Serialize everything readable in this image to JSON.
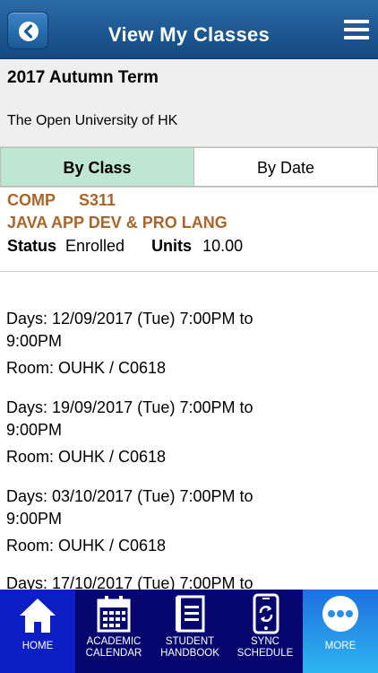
{
  "header": {
    "title": "View My Classes"
  },
  "term": {
    "title": "2017 Autumn Term",
    "university": "The Open University of HK"
  },
  "tabs": {
    "by_class": "By Class",
    "by_date": "By Date"
  },
  "class": {
    "subject": "COMP",
    "catalog": "S311",
    "name": "JAVA APP DEV & PRO LANG",
    "status_label": "Status",
    "status_value": "Enrolled",
    "units_label": "Units",
    "units_value": "10.00"
  },
  "sessions": [
    {
      "days": "Days: 12/09/2017 (Tue) 7:00PM to 9:00PM",
      "room": "Room: OUHK / C0618"
    },
    {
      "days": "Days: 19/09/2017 (Tue) 7:00PM to 9:00PM",
      "room": "Room: OUHK / C0618"
    },
    {
      "days": "Days: 03/10/2017 (Tue) 7:00PM to 9:00PM",
      "room": "Room: OUHK / C0618"
    },
    {
      "days": "Days: 17/10/2017 (Tue) 7:00PM to",
      "room": ""
    }
  ],
  "nav": {
    "home": "HOME",
    "calendar_1": "ACADEMIC",
    "calendar_2": "CALENDAR",
    "handbook_1": "STUDENT",
    "handbook_2": "HANDBOOK",
    "sync_1": "SYNC",
    "sync_2": "SCHEDULE",
    "more": "MORE"
  },
  "colors": {
    "header": "#1f5a96",
    "course": "#a8662c",
    "active_tab": "#bfe6d1",
    "nav_bg": "#06066e",
    "home_bg": "#0c1ec4"
  },
  "icons": [
    "back-arrow-icon",
    "hamburger-menu-icon",
    "home-icon",
    "calendar-icon",
    "handbook-icon",
    "sync-phone-icon",
    "more-dots-icon"
  ]
}
